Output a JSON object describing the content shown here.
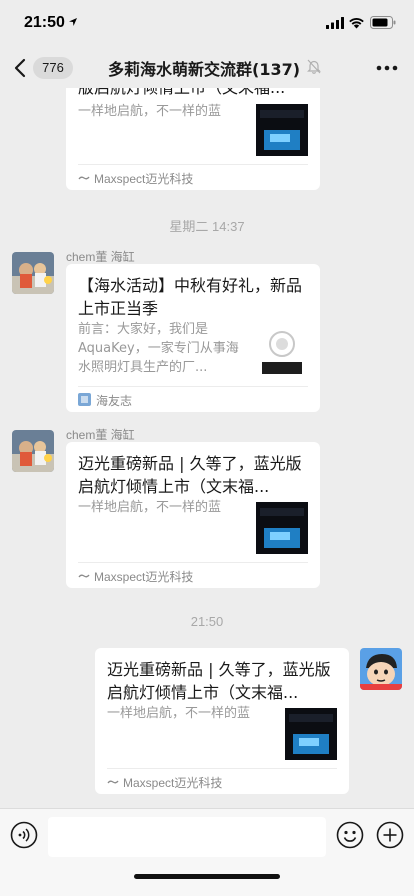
{
  "status_bar": {
    "time": "21:50"
  },
  "nav": {
    "unread_count": "776",
    "title": "多莉海水萌新交流群(137)"
  },
  "messages": {
    "top_card": {
      "title_partial": "版启航灯倾情上市（文末福...",
      "description": "一样地启航，不一样的蓝",
      "source": "Maxspect迈光科技"
    },
    "time_1": "星期二 14:37",
    "msg1": {
      "sender": "chem董 海缸",
      "title": "【海水活动】中秋有好礼，新品上市正当季",
      "description": "前言：大家好，我们是AquaKey，一家专门从事海水照明灯具生产的厂...",
      "source": "海友志"
    },
    "msg2": {
      "sender": "chem董 海缸",
      "title": "迈光重磅新品 | 久等了，蓝光版启航灯倾情上市（文末福...",
      "description": "一样地启航，不一样的蓝",
      "source": "Maxspect迈光科技"
    },
    "time_2": "21:50",
    "msg3": {
      "title": "迈光重磅新品 | 久等了，蓝光版启航灯倾情上市（文末福...",
      "description": "一样地启航，不一样的蓝",
      "source": "Maxspect迈光科技"
    }
  },
  "input_bar": {
    "placeholder": ""
  },
  "colors": {
    "background": "#ededed",
    "card": "#ffffff",
    "muted_text": "#999999"
  }
}
